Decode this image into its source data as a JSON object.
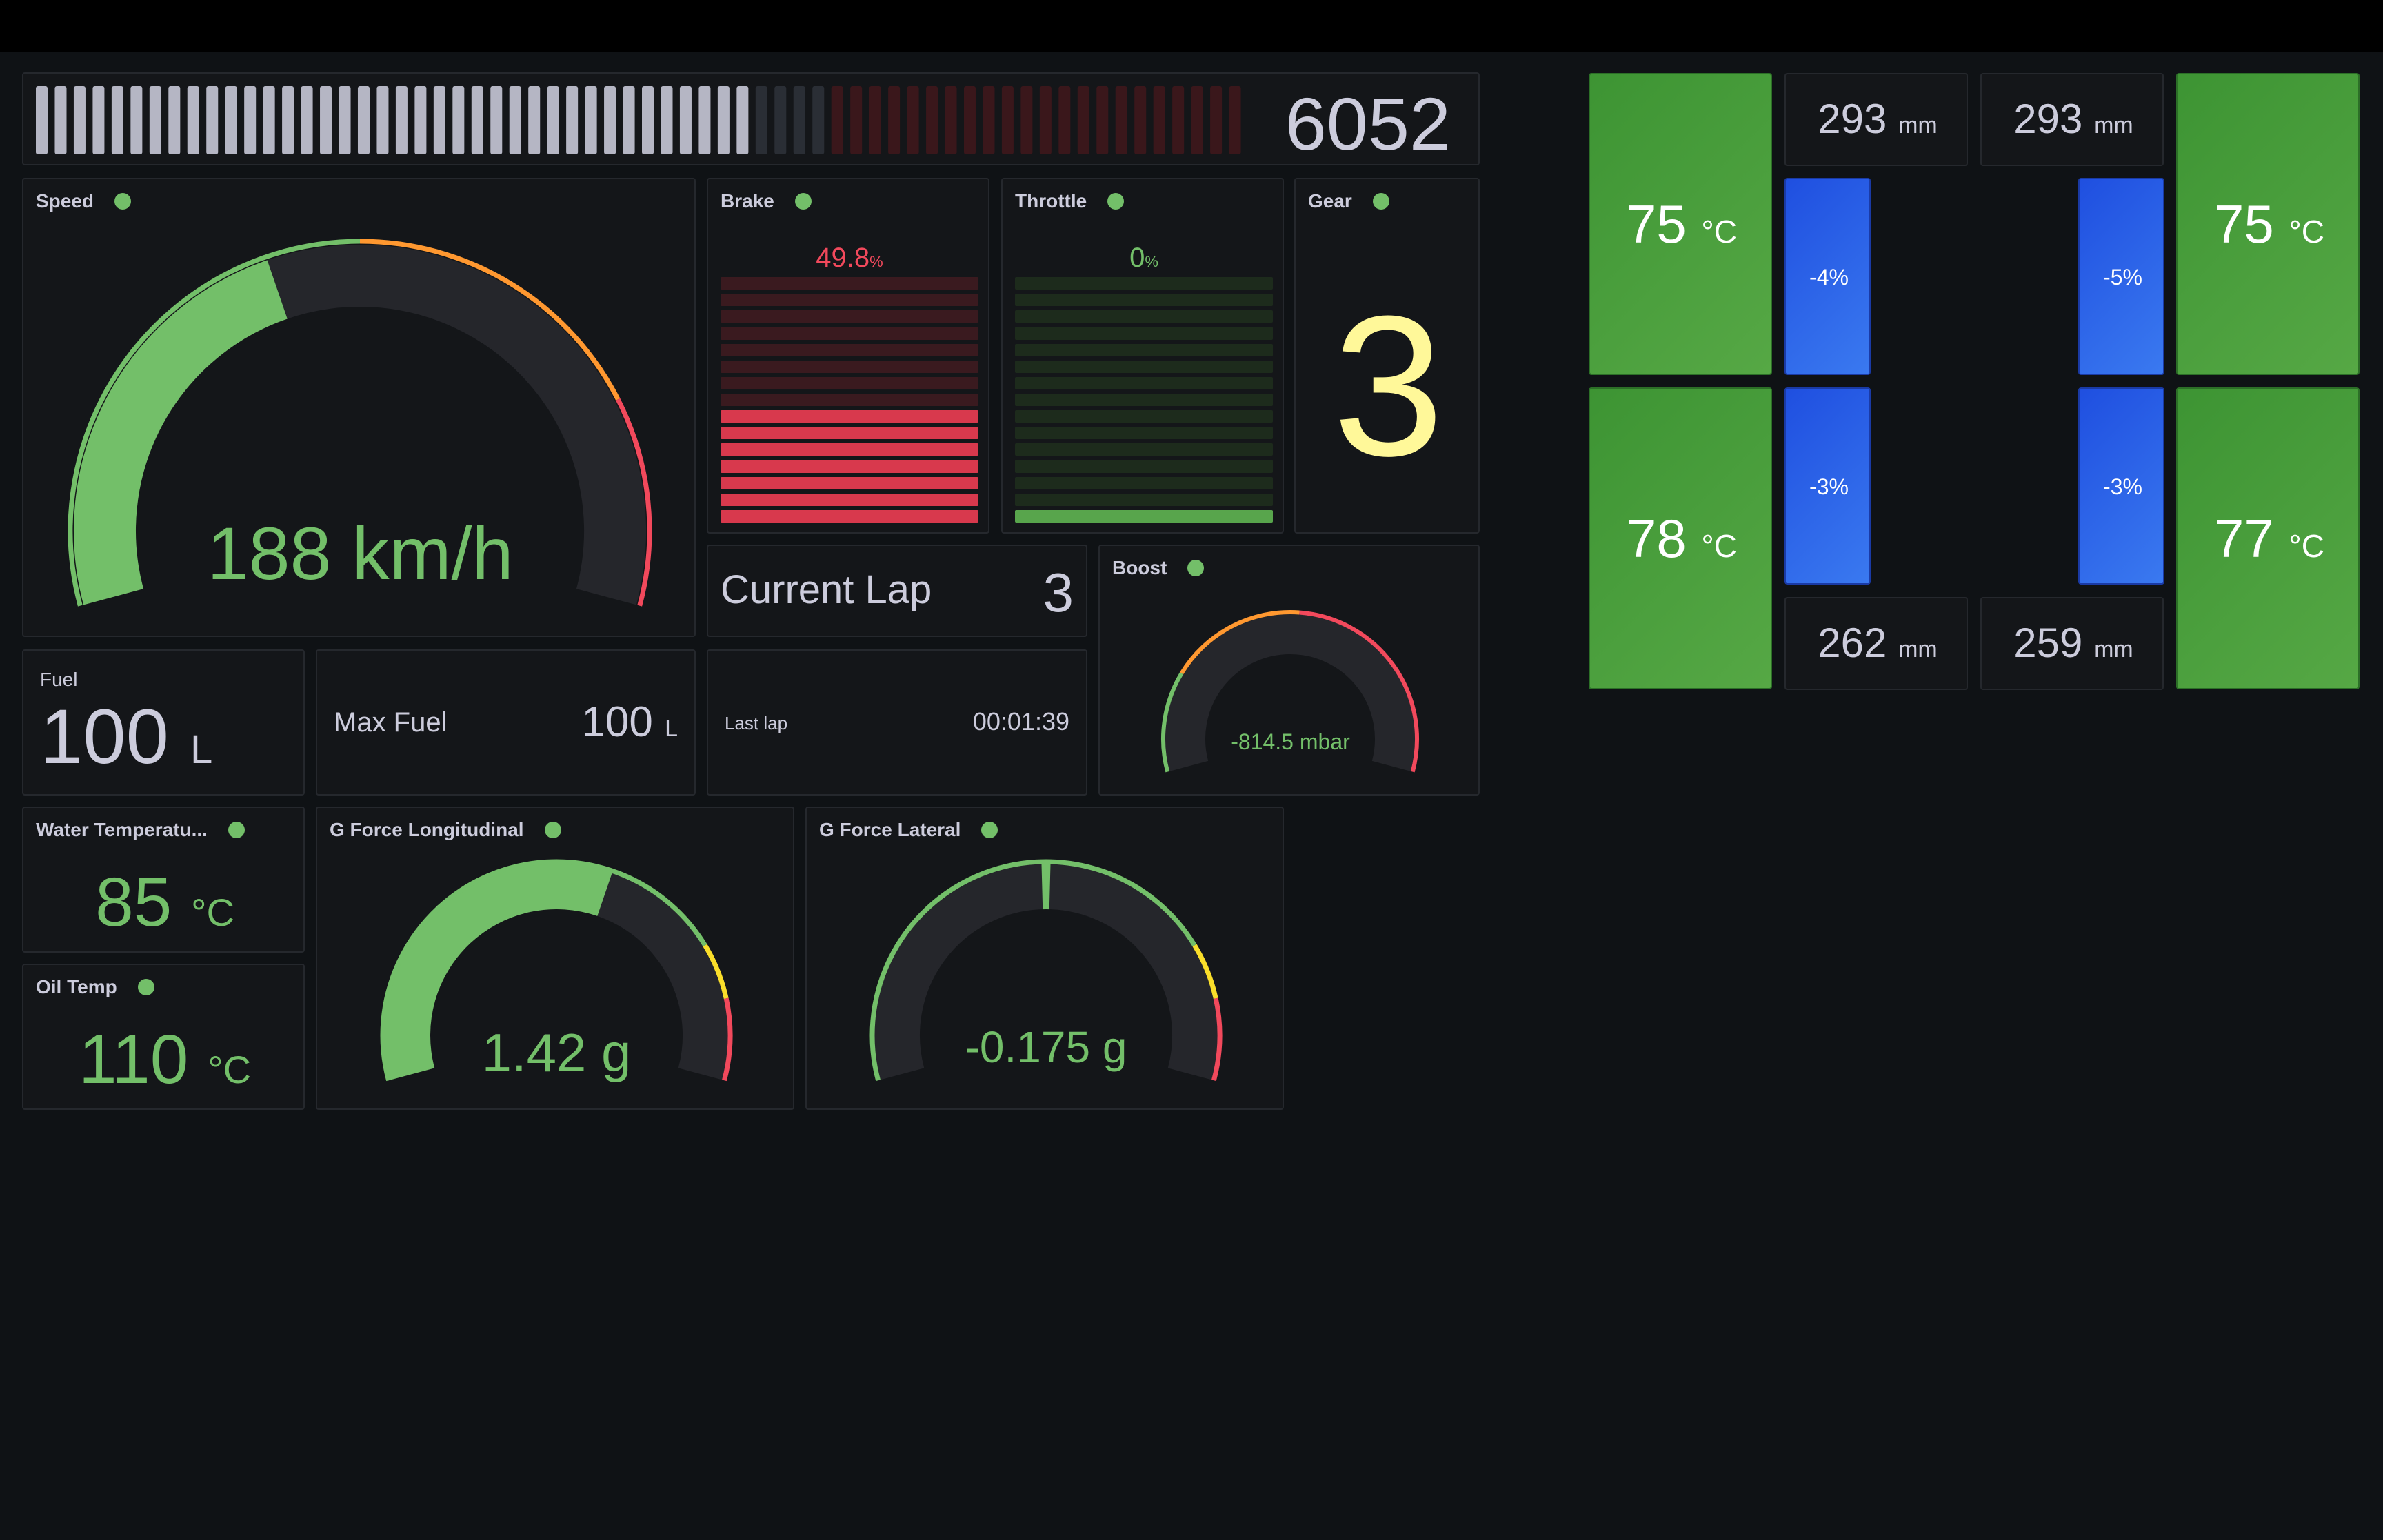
{
  "rpm": {
    "value": "6052",
    "fraction": 0.6,
    "total_segments": 64,
    "active_segments": 38
  },
  "speed": {
    "title": "Speed",
    "value": "188 km/h",
    "fraction": 0.41
  },
  "brake": {
    "title": "Brake",
    "value": "49.8",
    "unit": "%",
    "fraction": 0.498
  },
  "throttle": {
    "title": "Throttle",
    "value": "0",
    "unit": "%",
    "fraction": 0.0
  },
  "gear": {
    "title": "Gear",
    "value": "3"
  },
  "current_lap": {
    "label": "Current Lap",
    "value": "3"
  },
  "boost": {
    "title": "Boost",
    "value": "-814.5 mbar"
  },
  "fuel": {
    "title": "Fuel",
    "value": "100",
    "unit": "L"
  },
  "max_fuel": {
    "label": "Max Fuel",
    "value": "100",
    "unit": "L"
  },
  "last_lap": {
    "label": "Last lap",
    "value": "00:01:39"
  },
  "water_temp": {
    "title": "Water Temperatu...",
    "value": "85",
    "unit": "°C"
  },
  "oil_temp": {
    "title": "Oil Temp",
    "value": "110",
    "unit": "°C"
  },
  "g_long": {
    "title": "G Force Longitudinal",
    "value": "1.42 g",
    "fraction": 0.59
  },
  "g_lat": {
    "title": "G Force Lateral",
    "value": "-0.175 g",
    "fraction": 0.5
  },
  "tires": {
    "fl_temp": "75",
    "fr_temp": "75",
    "rl_temp": "78",
    "rr_temp": "77",
    "temp_unit": "°C",
    "fl_wear": "-4%",
    "fr_wear": "-5%",
    "rl_wear": "-3%",
    "rr_wear": "-3%",
    "fl_susp": "293",
    "fr_susp": "293",
    "rl_susp": "262",
    "rr_susp": "259",
    "susp_unit": "mm"
  },
  "colors": {
    "green": "#73bf69",
    "red": "#f2495c",
    "orange": "#ff9830",
    "yellow": "#fade2a",
    "gear": "#fff899"
  }
}
